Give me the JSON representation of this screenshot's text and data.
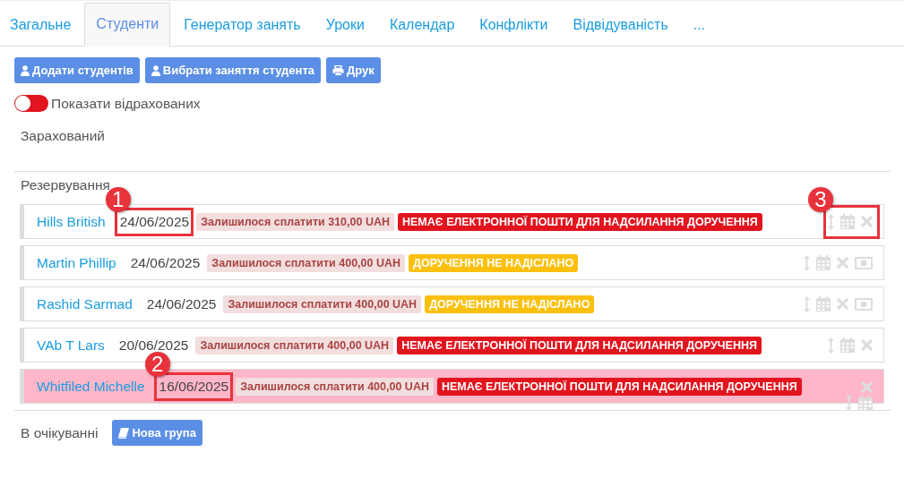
{
  "tabs": [
    {
      "label": "Загальне",
      "selected": false
    },
    {
      "label": "Студенти",
      "selected": true
    },
    {
      "label": "Генератор занять",
      "selected": false
    },
    {
      "label": "Уроки",
      "selected": false
    },
    {
      "label": "Календар",
      "selected": false
    },
    {
      "label": "Конфлікти",
      "selected": false
    },
    {
      "label": "Відвідуваність",
      "selected": false
    },
    {
      "label": "...",
      "selected": false
    }
  ],
  "toolbar": [
    {
      "label": "Додати студентів"
    },
    {
      "label": "Вибрати заняття студента"
    },
    {
      "label": "Друк"
    }
  ],
  "toggle": {
    "label": "Показати відрахованих",
    "on": false
  },
  "enrolled_heading": "Зарахований",
  "reservation_heading": "Резервування",
  "rows": [
    {
      "name": "Hills British",
      "date": "24/06/2025",
      "balance": "Залишилося сплатити 310,00 UAH",
      "status": {
        "kind": "no_email",
        "text": "НЕМАЄ ЕЛЕКТРОННОЇ ПОШТИ ДЛЯ НАДСИЛАННЯ ДОРУЧЕННЯ"
      },
      "actions": [
        {
          "kind": "move"
        },
        {
          "kind": "calendar"
        },
        {
          "kind": "delete"
        }
      ],
      "highlighted": false,
      "date_callout": "1",
      "actions_callout": "3"
    },
    {
      "name": "Martin Phillip",
      "date": "24/06/2025",
      "balance": "Залишилося сплатити 400,00 UAH",
      "status": {
        "kind": "not_sent",
        "text": "ДОРУЧЕННЯ НЕ НАДІСЛАНО"
      },
      "actions": [
        {
          "kind": "move"
        },
        {
          "kind": "calendar"
        },
        {
          "kind": "delete"
        },
        {
          "kind": "money"
        }
      ],
      "highlighted": false
    },
    {
      "name": "Rashid Sarmad",
      "date": "24/06/2025",
      "balance": "Залишилося сплатити 400,00 UAH",
      "status": {
        "kind": "not_sent",
        "text": "ДОРУЧЕННЯ НЕ НАДІСЛАНО"
      },
      "actions": [
        {
          "kind": "move"
        },
        {
          "kind": "calendar"
        },
        {
          "kind": "delete"
        },
        {
          "kind": "money"
        }
      ],
      "highlighted": false
    },
    {
      "name": "VAb T Lars",
      "date": "20/06/2025",
      "balance": "Залишилося сплатити 400,00 UAH",
      "status": {
        "kind": "no_email",
        "text": "НЕМАЄ ЕЛЕКТРОННОЇ ПОШТИ ДЛЯ НАДСИЛАННЯ ДОРУЧЕННЯ"
      },
      "actions": [
        {
          "kind": "move"
        },
        {
          "kind": "calendar"
        },
        {
          "kind": "delete"
        }
      ],
      "highlighted": false
    },
    {
      "name": "Whitfiled Michelle",
      "date": "16/06/2025",
      "balance": "Залишилося сплатити 400,00 UAH",
      "status": {
        "kind": "no_email",
        "text": "НЕМАЄ ЕЛЕКТРОННОЇ ПОШТИ ДЛЯ НАДСИЛАННЯ ДОРУЧЕННЯ"
      },
      "actions": [
        {
          "kind": "move"
        },
        {
          "kind": "calendar"
        },
        {
          "kind": "delete"
        }
      ],
      "highlighted": true,
      "date_callout": "2"
    }
  ],
  "waiting": {
    "label": "В очікуванні",
    "button": "Нова група"
  }
}
